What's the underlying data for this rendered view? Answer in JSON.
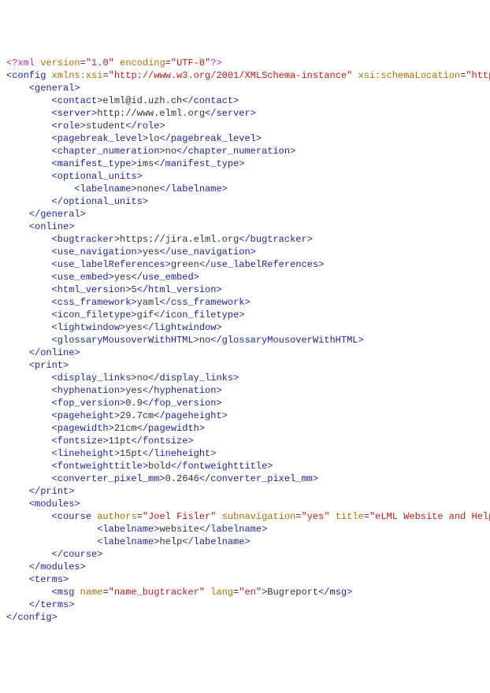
{
  "xml_declaration": {
    "version": "1.0",
    "encoding": "UTF-8"
  },
  "config": {
    "xmlns_xsi": "http://www.w3.org/2001/XMLSchema-instance",
    "xsi_schemaLocation": "http://",
    "general": {
      "contact": "elml@id.uzh.ch",
      "server": "http://www.elml.org",
      "role": "student",
      "pagebreak_level": "lo",
      "chapter_numeration": "no",
      "manifest_type": "ims",
      "optional_units": {
        "labelname": "none"
      }
    },
    "online": {
      "bugtracker": "https://jira.elml.org",
      "use_navigation": "yes",
      "use_labelReferences": "green",
      "use_embed": "yes",
      "html_version": "5",
      "css_framework": "yaml",
      "icon_filetype": "gif",
      "lightwindow": "yes",
      "glossaryMousoverWithHTML": "no"
    },
    "print": {
      "display_links": "no",
      "hyphenation": "yes",
      "fop_version": "0.9",
      "pageheight": "29.7cm",
      "pagewidth": "21cm",
      "fontsize": "11pt",
      "lineheight": "15pt",
      "fontweighttitle": "bold",
      "converter_pixel_mm": "0.2646"
    },
    "modules": {
      "course": {
        "authors": "Joel Fisler",
        "subnavigation": "yes",
        "title": "eLML Website and Help",
        "labelname1": "website",
        "labelname2": "help"
      }
    },
    "terms": {
      "msg": {
        "name": "name_bugtracker",
        "lang": "en",
        "text": "Bugreport"
      }
    }
  }
}
